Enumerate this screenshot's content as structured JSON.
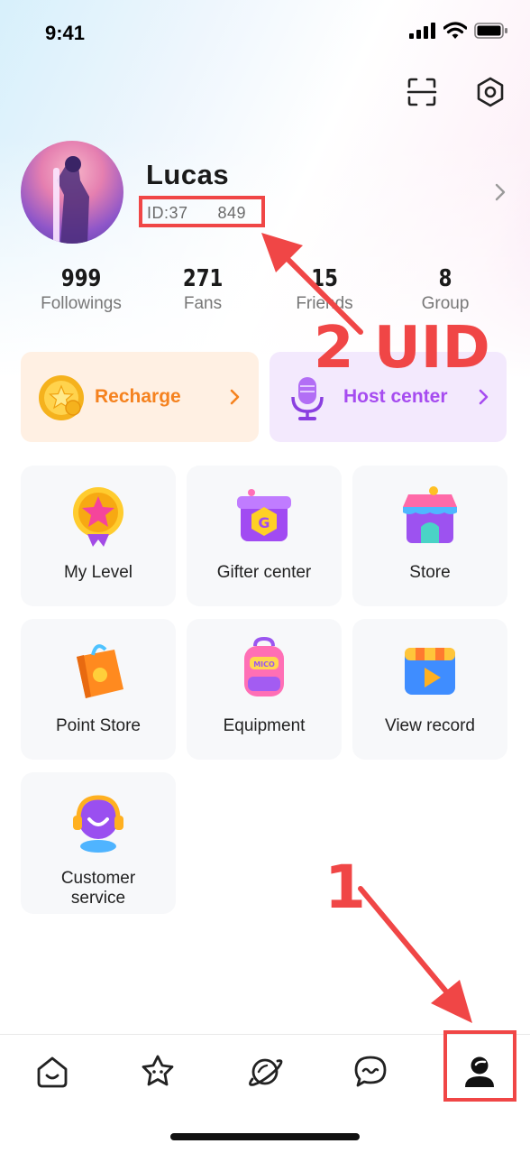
{
  "status_bar": {
    "time": "9:41"
  },
  "header": {
    "scan_icon": "scan-icon",
    "settings_icon": "settings-icon"
  },
  "profile": {
    "username": "Lucas",
    "uid": "ID:37      849"
  },
  "stats": [
    {
      "value": "999",
      "label": "Followings"
    },
    {
      "value": "271",
      "label": "Fans"
    },
    {
      "value": "15",
      "label": "Friends"
    },
    {
      "value": "8",
      "label": "Group"
    }
  ],
  "banners": {
    "recharge": {
      "label": "Recharge",
      "color": "#f5821f"
    },
    "host": {
      "label": "Host center",
      "color": "#a64cf0"
    }
  },
  "menu": [
    {
      "label": "My Level"
    },
    {
      "label": "Gifter center"
    },
    {
      "label": "Store"
    },
    {
      "label": "Point Store"
    },
    {
      "label": "Equipment"
    },
    {
      "label": "View record"
    },
    {
      "label": "Customer\nservice"
    }
  ],
  "annotations": {
    "step1": "1",
    "step2": "2 UID",
    "color": "#f04646"
  },
  "bottom_nav": [
    "home-icon",
    "star-icon",
    "planet-icon",
    "chat-icon",
    "profile-icon"
  ]
}
